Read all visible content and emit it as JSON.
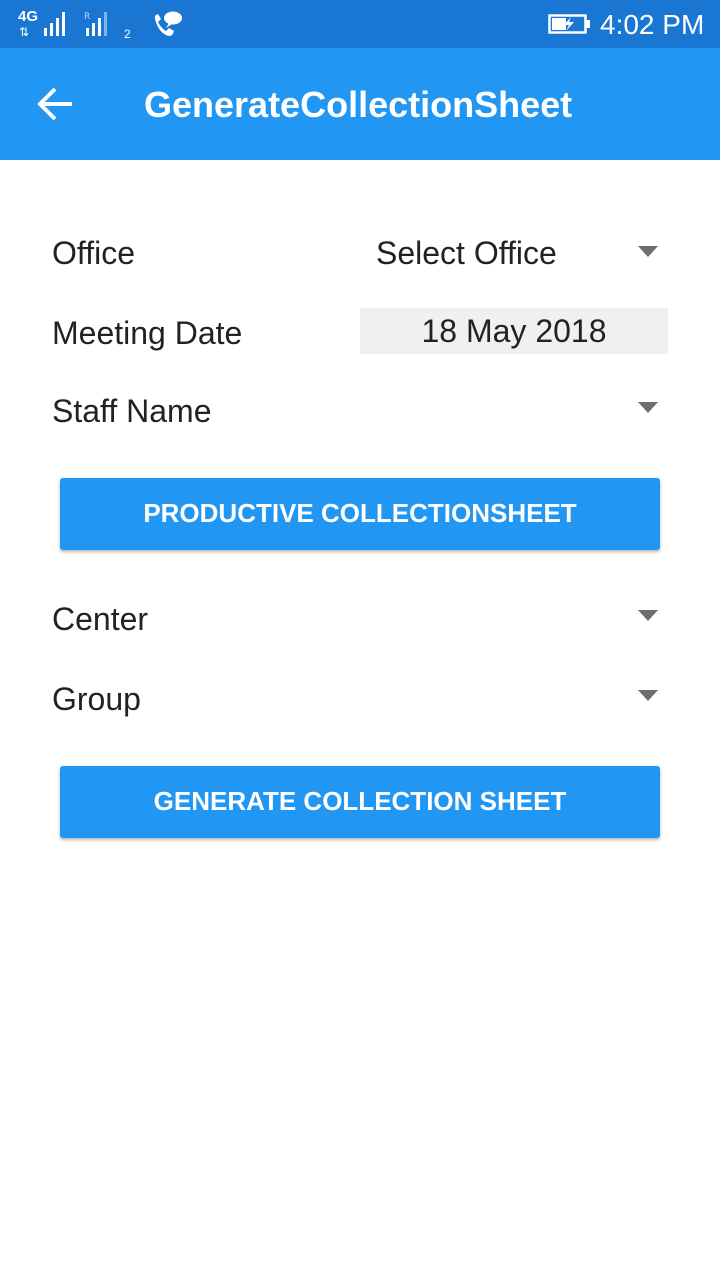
{
  "status_bar": {
    "network": "4G",
    "roaming_mark": "R",
    "sim_slot": "2",
    "time": "4:02 PM",
    "icons": [
      "signal-strength-icon",
      "phone-call-icon",
      "battery-charging-icon"
    ]
  },
  "app_bar": {
    "title": "GenerateCollectionSheet",
    "back_icon": "arrow-back-icon",
    "color": "#2196f3"
  },
  "form": {
    "office": {
      "label": "Office",
      "value": "Select Office"
    },
    "meeting_date": {
      "label": "Meeting Date",
      "value": "18 May 2018"
    },
    "staff_name": {
      "label": "Staff Name",
      "value": ""
    },
    "productive_button": "PRODUCTIVE COLLECTIONSHEET",
    "center": {
      "label": "Center",
      "value": ""
    },
    "group": {
      "label": "Group",
      "value": ""
    },
    "generate_button": "GENERATE COLLECTION SHEET"
  },
  "colors": {
    "status_bar": "#1976d2",
    "primary": "#2196f3",
    "date_field_bg": "#f0f0f0"
  }
}
